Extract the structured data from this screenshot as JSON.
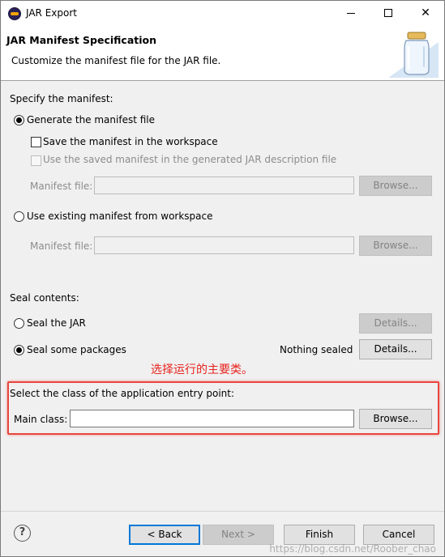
{
  "window": {
    "title": "JAR Export",
    "minimize_icon": "minimize-icon",
    "maximize_icon": "maximize-icon",
    "close_glyph": "✕"
  },
  "header": {
    "title": "JAR Manifest Specification",
    "description": "Customize the manifest file for the JAR file.",
    "illustration": "jar-icon"
  },
  "manifest": {
    "section_label": "Specify the manifest:",
    "generate_label": "Generate the manifest file",
    "save_label": "Save the manifest in the workspace",
    "use_saved_label": "Use the saved manifest in the generated JAR description file",
    "manifest_file_label": "Manifest file:",
    "manifest_file_value": "",
    "browse_label": "Browse...",
    "use_existing_label": "Use existing manifest from workspace",
    "existing_file_label": "Manifest file:",
    "existing_file_value": "",
    "existing_browse_label": "Browse..."
  },
  "seal": {
    "section_label": "Seal contents:",
    "seal_jar_label": "Seal the JAR",
    "seal_jar_details": "Details...",
    "seal_some_label": "Seal some packages",
    "seal_status": "Nothing sealed",
    "seal_some_details": "Details..."
  },
  "annotation": {
    "text": "选择运行的主要类。",
    "color": "#e8231f"
  },
  "entry_point": {
    "section_label": "Select the class of the application entry point:",
    "main_class_label": "Main class:",
    "main_class_value": "",
    "browse_label": "Browse..."
  },
  "footer": {
    "help_glyph": "?",
    "back_label": "< Back",
    "next_label": "Next >",
    "finish_label": "Finish",
    "cancel_label": "Cancel",
    "watermark": "https://blog.csdn.net/Roober_chao"
  }
}
